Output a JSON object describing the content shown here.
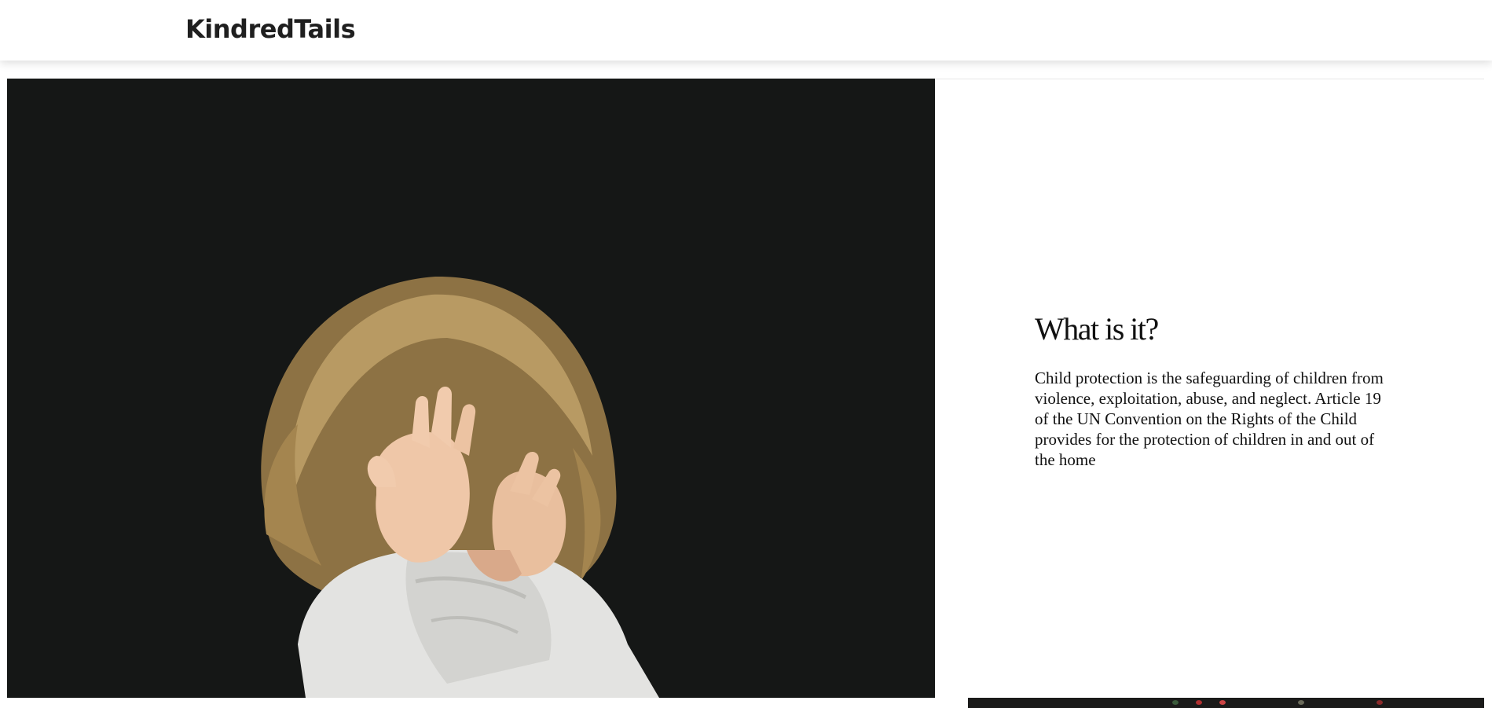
{
  "navbar": {
    "brand": "KindredTails"
  },
  "hero": {
    "image_alt": "Child covering face with hands"
  },
  "section": {
    "heading": "What is it?",
    "body": "Child protection is the safeguarding of children from violence, exploitation, abuse, and neglect. Article 19 of the UN Convention on the Rights of the Child provides for the protection of children in and out of the home"
  },
  "colors": {
    "photo_background": "#151716",
    "hair": "#a88a55",
    "shirt": "#e7e7e5",
    "skin": "#efc7a8",
    "text": "#111111"
  }
}
